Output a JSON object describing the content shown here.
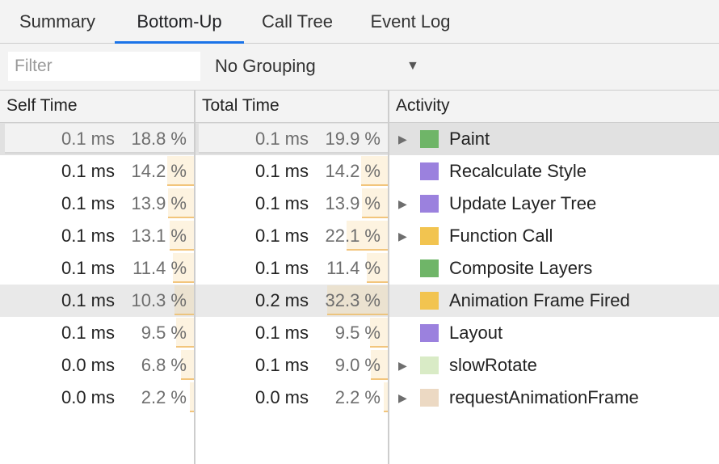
{
  "tabs": [
    {
      "label": "Summary"
    },
    {
      "label": "Bottom-Up",
      "active": true
    },
    {
      "label": "Call Tree"
    },
    {
      "label": "Event Log"
    }
  ],
  "toolbar": {
    "filter_placeholder": "Filter",
    "grouping_value": "No Grouping",
    "grouping_arrow": "▼"
  },
  "columns": {
    "self_time": "Self Time",
    "total_time": "Total Time",
    "activity": "Activity"
  },
  "colors": {
    "purple": "#9b81de",
    "green": "#6fb568",
    "yellow": "#f2c450",
    "light_green": "#d9ebc6",
    "light_tan": "#ecd9c3",
    "tab_active": "#1a73e8"
  },
  "rows": [
    {
      "self_ms": "0.1 ms",
      "self_pct": "18.8 %",
      "self_frac": 0.188,
      "total_ms": "0.1 ms",
      "total_pct": "19.9 %",
      "total_frac": 0.199,
      "activity": "Paint",
      "swatch": "#6fb568",
      "expandable": true,
      "state": "sel"
    },
    {
      "self_ms": "0.1 ms",
      "self_pct": "14.2 %",
      "self_frac": 0.142,
      "total_ms": "0.1 ms",
      "total_pct": "14.2 %",
      "total_frac": 0.142,
      "activity": "Recalculate Style",
      "swatch": "#9b81de",
      "expandable": false
    },
    {
      "self_ms": "0.1 ms",
      "self_pct": "13.9 %",
      "self_frac": 0.139,
      "total_ms": "0.1 ms",
      "total_pct": "13.9 %",
      "total_frac": 0.139,
      "activity": "Update Layer Tree",
      "swatch": "#9b81de",
      "expandable": true
    },
    {
      "self_ms": "0.1 ms",
      "self_pct": "13.1 %",
      "self_frac": 0.131,
      "total_ms": "0.1 ms",
      "total_pct": "22.1 %",
      "total_frac": 0.221,
      "activity": "Function Call",
      "swatch": "#f2c450",
      "expandable": true
    },
    {
      "self_ms": "0.1 ms",
      "self_pct": "11.4 %",
      "self_frac": 0.114,
      "total_ms": "0.1 ms",
      "total_pct": "11.4 %",
      "total_frac": 0.114,
      "activity": "Composite Layers",
      "swatch": "#6fb568",
      "expandable": false
    },
    {
      "self_ms": "0.1 ms",
      "self_pct": "10.3 %",
      "self_frac": 0.103,
      "total_ms": "0.2 ms",
      "total_pct": "32.3 %",
      "total_frac": 0.323,
      "activity": "Animation Frame Fired",
      "swatch": "#f2c450",
      "expandable": false,
      "state": "hover"
    },
    {
      "self_ms": "0.1 ms",
      "self_pct": "9.5 %",
      "self_frac": 0.095,
      "total_ms": "0.1 ms",
      "total_pct": "9.5 %",
      "total_frac": 0.095,
      "activity": "Layout",
      "swatch": "#9b81de",
      "expandable": false
    },
    {
      "self_ms": "0.0 ms",
      "self_pct": "6.8 %",
      "self_frac": 0.068,
      "total_ms": "0.1 ms",
      "total_pct": "9.0 %",
      "total_frac": 0.09,
      "activity": "slowRotate",
      "swatch": "#d9ebc6",
      "expandable": true
    },
    {
      "self_ms": "0.0 ms",
      "self_pct": "2.2 %",
      "self_frac": 0.022,
      "total_ms": "0.0 ms",
      "total_pct": "2.2 %",
      "total_frac": 0.022,
      "activity": "requestAnimationFrame",
      "swatch": "#ecd9c3",
      "expandable": true
    }
  ]
}
